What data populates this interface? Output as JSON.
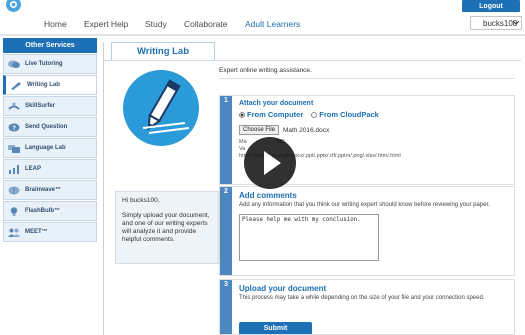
{
  "header": {
    "logout_label": "Logout",
    "nav": [
      "Home",
      "Expert Help",
      "Study",
      "Collaborate",
      "Adult Learners"
    ],
    "active_nav": "Adult Learners",
    "user_select": "bucks100"
  },
  "sidebar": {
    "title": "Other Services",
    "items": [
      {
        "label": "Live Tutoring",
        "icon": "chat-bubble-icon"
      },
      {
        "label": "Writing Lab",
        "icon": "pencil-icon"
      },
      {
        "label": "SkillSurfer",
        "icon": "surfer-icon"
      },
      {
        "label": "Send Question",
        "icon": "question-icon"
      },
      {
        "label": "Language Lab",
        "icon": "language-icon"
      },
      {
        "label": "LEAP",
        "icon": "chart-icon"
      },
      {
        "label": "Brainwave™",
        "icon": "brain-icon"
      },
      {
        "label": "FlashBulb™",
        "icon": "bulb-icon"
      },
      {
        "label": "MEET™",
        "icon": "people-icon"
      }
    ],
    "active_item": "Writing Lab"
  },
  "main": {
    "tab_label": "Writing Lab",
    "intro": "Expert online writing assistance.",
    "greeting": {
      "hi": "Hi bucks100,",
      "body": "Simply upload your document, and one of our writing experts will analyze it and provide helpful comments."
    },
    "steps": [
      {
        "number": "1",
        "title": "Attach your document",
        "radio_computer": "From Computer",
        "radio_cloud": "From CloudPack",
        "choose_label": "Choose File",
        "file_name": "Math 2016.docx",
        "max_size_text": "Ma",
        "size_limit_text": "MB",
        "valid_prefix": "Va",
        "valid_types": "html/.txt/.pdf/.jpg/.gif/.docx/.ppt/.pptx/.rtf/.pptm/.png/.xlsx/.htm/.html"
      },
      {
        "number": "2",
        "title": "Add comments",
        "description": "Add any information that you think our writing expert should know before reviewing your paper.",
        "comment_value": "Please help me with my conclusion."
      },
      {
        "number": "3",
        "title": "Upload your document",
        "description": "This process may take a while depending on the size of your file and your connection speed.",
        "submit_label": "Submit"
      }
    ]
  },
  "colors": {
    "accent": "#1e70b6",
    "step_number_bg": "#4c87bf",
    "sidebar_bg": "#e8f0f8",
    "illustration_bg": "#2a9bd8"
  }
}
